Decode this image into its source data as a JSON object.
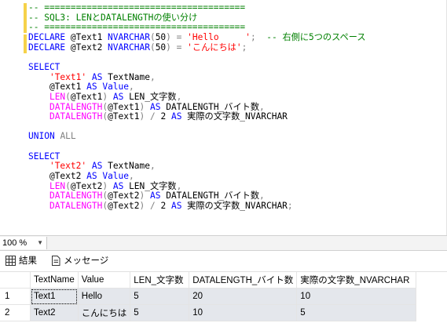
{
  "editor": {
    "lines": [
      [
        {
          "c": "cm",
          "t": "-- ======================================"
        }
      ],
      [
        {
          "c": "cm",
          "t": "-- SQL3: LENとDATALENGTHの使い分け"
        }
      ],
      [
        {
          "c": "cm",
          "t": "-- ======================================"
        }
      ],
      [
        {
          "c": "kw",
          "t": "DECLARE"
        },
        {
          "c": "plain",
          "t": " @Text1 "
        },
        {
          "c": "kw",
          "t": "NVARCHAR"
        },
        {
          "c": "op",
          "t": "("
        },
        {
          "c": "plain",
          "t": "50"
        },
        {
          "c": "op",
          "t": ")"
        },
        {
          "c": "plain",
          "t": " "
        },
        {
          "c": "op",
          "t": "="
        },
        {
          "c": "plain",
          "t": " "
        },
        {
          "c": "str",
          "t": "'Hello     '"
        },
        {
          "c": "op",
          "t": ";"
        },
        {
          "c": "plain",
          "t": "  "
        },
        {
          "c": "cm",
          "t": "-- 右側に5つのスペース"
        }
      ],
      [
        {
          "c": "kw",
          "t": "DECLARE"
        },
        {
          "c": "plain",
          "t": " @Text2 "
        },
        {
          "c": "kw",
          "t": "NVARCHAR"
        },
        {
          "c": "op",
          "t": "("
        },
        {
          "c": "plain",
          "t": "50"
        },
        {
          "c": "op",
          "t": ")"
        },
        {
          "c": "plain",
          "t": " "
        },
        {
          "c": "op",
          "t": "="
        },
        {
          "c": "plain",
          "t": " "
        },
        {
          "c": "str",
          "t": "'こんにちは'"
        },
        {
          "c": "op",
          "t": ";"
        }
      ],
      [],
      [
        {
          "c": "kw",
          "t": "SELECT"
        }
      ],
      [
        {
          "c": "plain",
          "t": "    "
        },
        {
          "c": "str",
          "t": "'Text1'"
        },
        {
          "c": "plain",
          "t": " "
        },
        {
          "c": "kw",
          "t": "AS"
        },
        {
          "c": "plain",
          "t": " TextName"
        },
        {
          "c": "op",
          "t": ","
        }
      ],
      [
        {
          "c": "plain",
          "t": "    @Text1 "
        },
        {
          "c": "kw",
          "t": "AS"
        },
        {
          "c": "plain",
          "t": " "
        },
        {
          "c": "kw",
          "t": "Value"
        },
        {
          "c": "op",
          "t": ","
        }
      ],
      [
        {
          "c": "plain",
          "t": "    "
        },
        {
          "c": "fn",
          "t": "LEN"
        },
        {
          "c": "op",
          "t": "("
        },
        {
          "c": "plain",
          "t": "@Text1"
        },
        {
          "c": "op",
          "t": ")"
        },
        {
          "c": "plain",
          "t": " "
        },
        {
          "c": "kw",
          "t": "AS"
        },
        {
          "c": "plain",
          "t": " LEN_文字数"
        },
        {
          "c": "op",
          "t": ","
        }
      ],
      [
        {
          "c": "plain",
          "t": "    "
        },
        {
          "c": "fn",
          "t": "DATALENGTH"
        },
        {
          "c": "op",
          "t": "("
        },
        {
          "c": "plain",
          "t": "@Text1"
        },
        {
          "c": "op",
          "t": ")"
        },
        {
          "c": "plain",
          "t": " "
        },
        {
          "c": "kw",
          "t": "AS"
        },
        {
          "c": "plain",
          "t": " DATALENGTH_バイト数"
        },
        {
          "c": "op",
          "t": ","
        }
      ],
      [
        {
          "c": "plain",
          "t": "    "
        },
        {
          "c": "fn",
          "t": "DATALENGTH"
        },
        {
          "c": "op",
          "t": "("
        },
        {
          "c": "plain",
          "t": "@Text1"
        },
        {
          "c": "op",
          "t": ")"
        },
        {
          "c": "plain",
          "t": " "
        },
        {
          "c": "op",
          "t": "/"
        },
        {
          "c": "plain",
          "t": " 2 "
        },
        {
          "c": "kw",
          "t": "AS"
        },
        {
          "c": "plain",
          "t": " 実際の文字数_NVARCHAR"
        }
      ],
      [],
      [
        {
          "c": "kw",
          "t": "UNION"
        },
        {
          "c": "plain",
          "t": " "
        },
        {
          "c": "op",
          "t": "ALL"
        }
      ],
      [],
      [
        {
          "c": "kw",
          "t": "SELECT"
        }
      ],
      [
        {
          "c": "plain",
          "t": "    "
        },
        {
          "c": "str",
          "t": "'Text2'"
        },
        {
          "c": "plain",
          "t": " "
        },
        {
          "c": "kw",
          "t": "AS"
        },
        {
          "c": "plain",
          "t": " TextName"
        },
        {
          "c": "op",
          "t": ","
        }
      ],
      [
        {
          "c": "plain",
          "t": "    @Text2 "
        },
        {
          "c": "kw",
          "t": "AS"
        },
        {
          "c": "plain",
          "t": " "
        },
        {
          "c": "kw",
          "t": "Value"
        },
        {
          "c": "op",
          "t": ","
        }
      ],
      [
        {
          "c": "plain",
          "t": "    "
        },
        {
          "c": "fn",
          "t": "LEN"
        },
        {
          "c": "op",
          "t": "("
        },
        {
          "c": "plain",
          "t": "@Text2"
        },
        {
          "c": "op",
          "t": ")"
        },
        {
          "c": "plain",
          "t": " "
        },
        {
          "c": "kw",
          "t": "AS"
        },
        {
          "c": "plain",
          "t": " LEN_文字数"
        },
        {
          "c": "op",
          "t": ","
        }
      ],
      [
        {
          "c": "plain",
          "t": "    "
        },
        {
          "c": "fn",
          "t": "DATALENGTH"
        },
        {
          "c": "op",
          "t": "("
        },
        {
          "c": "plain",
          "t": "@Text2"
        },
        {
          "c": "op",
          "t": ")"
        },
        {
          "c": "plain",
          "t": " "
        },
        {
          "c": "kw",
          "t": "AS"
        },
        {
          "c": "plain",
          "t": " DATALENGTH_バイト数"
        },
        {
          "c": "op",
          "t": ","
        }
      ],
      [
        {
          "c": "plain",
          "t": "    "
        },
        {
          "c": "fn",
          "t": "DATALENGTH"
        },
        {
          "c": "op",
          "t": "("
        },
        {
          "c": "plain",
          "t": "@Text2"
        },
        {
          "c": "op",
          "t": ")"
        },
        {
          "c": "plain",
          "t": " "
        },
        {
          "c": "op",
          "t": "/"
        },
        {
          "c": "plain",
          "t": " 2 "
        },
        {
          "c": "kw",
          "t": "AS"
        },
        {
          "c": "plain",
          "t": " 実際の文字数_NVARCHAR"
        },
        {
          "c": "op",
          "t": ";"
        }
      ]
    ]
  },
  "statusbar": {
    "zoom": "100 %",
    "zoom_arrow": "▼"
  },
  "tabs": {
    "results_label": "結果",
    "messages_label": "メッセージ"
  },
  "grid": {
    "columns": [
      "TextName",
      "Value",
      "LEN_文字数",
      "DATALENGTH_バイト数",
      "実際の文字数_NVARCHAR"
    ],
    "rows": [
      {
        "num": "1",
        "cells": [
          "Text1",
          "Hello",
          "5",
          "20",
          "10"
        ]
      },
      {
        "num": "2",
        "cells": [
          "Text2",
          "こんにちは",
          "5",
          "10",
          "5"
        ]
      }
    ]
  },
  "colors": {
    "keyword": "#0000ff",
    "function": "#ff00ff",
    "string": "#ff0000",
    "comment": "#008000",
    "operator": "#808080",
    "selected_row_bg": "#e4e7ec"
  }
}
